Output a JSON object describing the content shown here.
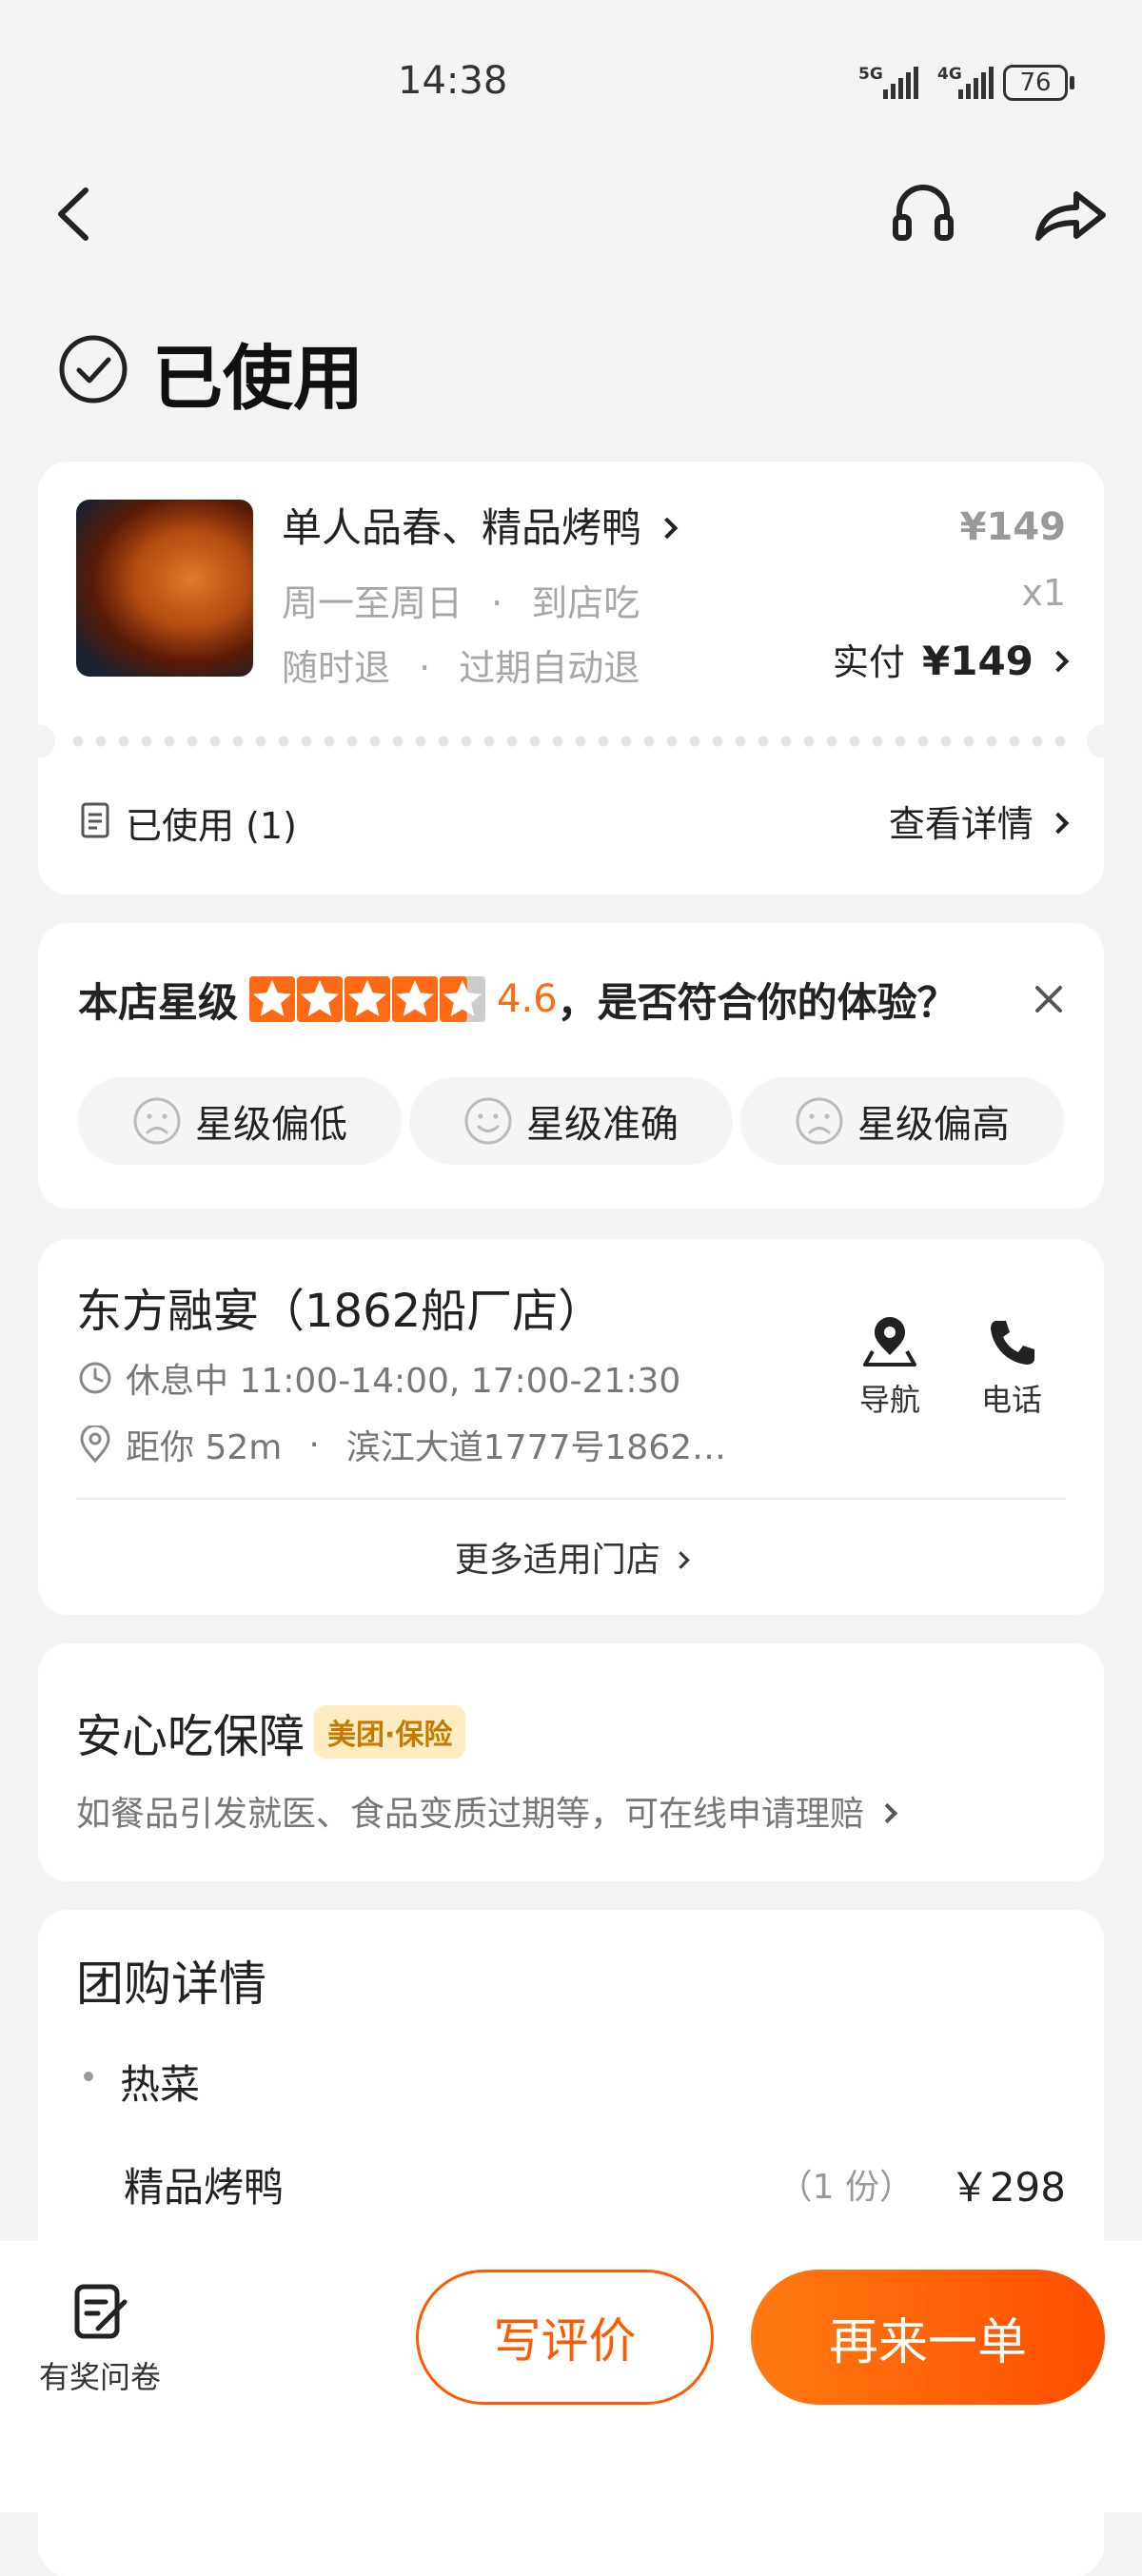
{
  "status_bar": {
    "time": "14:38",
    "net1": "5G",
    "net2": "4G",
    "battery": "76"
  },
  "header": {
    "title": "已使用"
  },
  "order": {
    "name": "单人品春、精品烤鸭",
    "line2_a": "周一至周日",
    "line2_b": "到店吃",
    "line3_a": "随时退",
    "line3_b": "过期自动退",
    "price": "¥149",
    "qty": "x1",
    "paid_label": "实付",
    "paid_value": "¥149",
    "used_label": "已使用 (1)",
    "detail_link": "查看详情"
  },
  "rating": {
    "label": "本店星级",
    "score": "4.6",
    "stars": 4.6,
    "question": "，是否符合你的体验？",
    "options": [
      "星级偏低",
      "星级准确",
      "星级偏高"
    ]
  },
  "store": {
    "name": "东方融宴（1862船厂店）",
    "hours": "休息中 11:00-14:00, 17:00-21:30",
    "distance": "距你 52m",
    "address": "滨江大道1777号1862…",
    "nav_label": "导航",
    "phone_label": "电话",
    "more_stores": "更多适用门店"
  },
  "guarantee": {
    "title": "安心吃保障",
    "badge": "美团·保险",
    "desc": "如餐品引发就医、食品变质过期等，可在线申请理赔"
  },
  "deal": {
    "title": "团购详情",
    "category": "热菜",
    "item_name": "精品烤鸭",
    "item_qty": "（1 份）",
    "item_price": "￥298"
  },
  "bottom_bar": {
    "survey_label": "有奖问卷",
    "review_btn": "写评价",
    "reorder_btn": "再来一单"
  },
  "colors": {
    "accent": "#ff5a00",
    "star": "#ff6a14",
    "badge_bg": "#ffedc2",
    "badge_text": "#c57a00"
  }
}
